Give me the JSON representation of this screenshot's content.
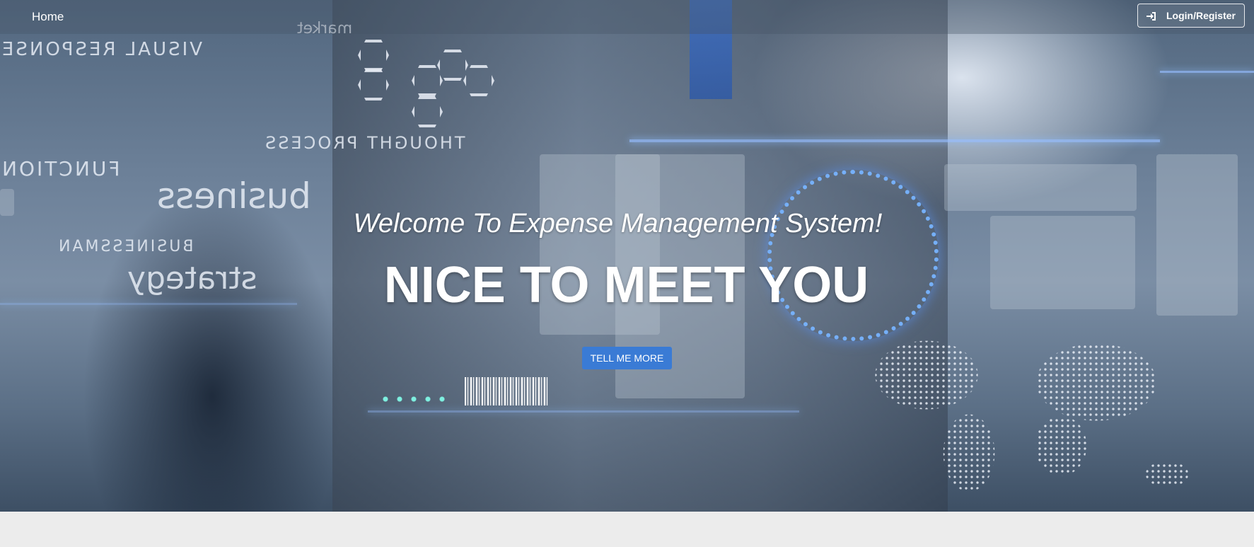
{
  "navbar": {
    "home_label": "Home",
    "login_label": "Login/Register",
    "login_icon": "sign-in-icon"
  },
  "hero": {
    "welcome_text": "Welcome To Expense Management System!",
    "headline": "NICE TO MEET YOU",
    "cta_label": "TELL ME MORE"
  },
  "colors": {
    "cta_background": "#3a7bd5",
    "footer_strip": "#ececec",
    "text": "#ffffff"
  }
}
